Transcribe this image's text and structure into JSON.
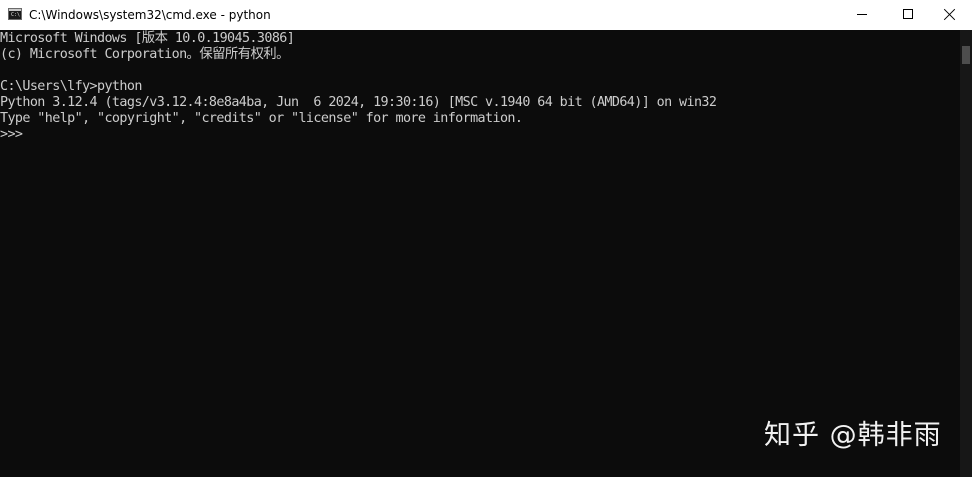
{
  "window": {
    "title": "C:\\Windows\\system32\\cmd.exe - python",
    "icon": "cmd-console-icon",
    "icon_text": "C:\\"
  },
  "controls": {
    "minimize_icon": "minimize-icon",
    "maximize_icon": "maximize-icon",
    "close_icon": "close-icon"
  },
  "console": {
    "lines": [
      "Microsoft Windows [版本 10.0.19045.3086]",
      "(c) Microsoft Corporation。保留所有权利。",
      "",
      "C:\\Users\\lfy>python",
      "Python 3.12.4 (tags/v3.12.4:8e8a4ba, Jun  6 2024, 19:30:16) [MSC v.1940 64 bit (AMD64)] on win32",
      "Type \"help\", \"copyright\", \"credits\" or \"license\" for more information.",
      ">>> "
    ]
  },
  "watermark": {
    "text": "知乎 @韩非雨"
  },
  "colors": {
    "console_background": "#0c0c0c",
    "console_text": "#cccccc",
    "titlebar_background": "#ffffff"
  }
}
